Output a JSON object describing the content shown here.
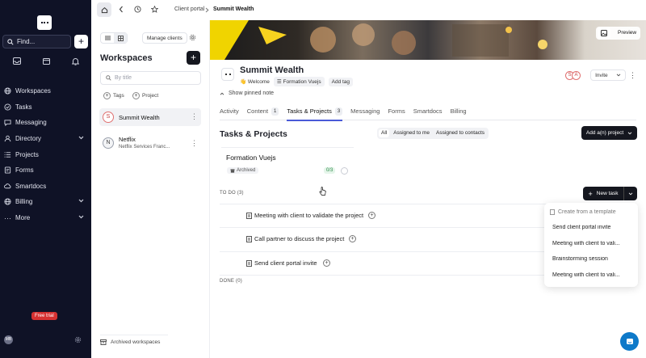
{
  "sidebar": {
    "find_placeholder": "Find...",
    "nav": [
      {
        "label": "Workspaces",
        "icon": "globe-icon"
      },
      {
        "label": "Tasks",
        "icon": "check-circle-icon"
      },
      {
        "label": "Messaging",
        "icon": "chat-icon"
      },
      {
        "label": "Directory",
        "icon": "user-icon",
        "expandable": true
      },
      {
        "label": "Projects",
        "icon": "list-icon"
      },
      {
        "label": "Forms",
        "icon": "form-icon"
      },
      {
        "label": "Smartdocs",
        "icon": "cloud-icon"
      },
      {
        "label": "Billing",
        "icon": "globe-icon",
        "expandable": true
      },
      {
        "label": "More",
        "icon": "dots-icon",
        "expandable": true
      }
    ],
    "free_trial": "Free trial",
    "user_initials": "MB"
  },
  "topbar": {
    "breadcrumb_root": "Client portal",
    "breadcrumb_current": "Summit Wealth"
  },
  "workspaces": {
    "manage_label": "Manage clients",
    "title": "Workspaces",
    "search_placeholder": "By title",
    "filter_tags": "Tags",
    "filter_project": "Project",
    "items": [
      {
        "initial": "S",
        "name": "Summit Wealth",
        "subtitle": ""
      },
      {
        "initial": "N",
        "name": "Netflix",
        "subtitle": "Netflix Services Franc..."
      }
    ],
    "archived_label": "Archived workspaces"
  },
  "main": {
    "preview_label": "Preview",
    "client_name": "Summit Wealth",
    "welcome_label": "Welcome",
    "welcome_emoji": "👋",
    "tag_formation": "Formation Vuejs",
    "add_tag_label": "Add tag",
    "avatars": [
      "S",
      "A"
    ],
    "invite_label": "Invite",
    "pinned_label": "Show pinned note",
    "tabs": [
      {
        "label": "Activity",
        "count": ""
      },
      {
        "label": "Content",
        "count": "1"
      },
      {
        "label": "Tasks & Projects",
        "count": "3"
      },
      {
        "label": "Messaging",
        "count": ""
      },
      {
        "label": "Forms",
        "count": ""
      },
      {
        "label": "Smartdocs",
        "count": ""
      },
      {
        "label": "Billing",
        "count": ""
      }
    ],
    "section_title": "Tasks & Projects",
    "filters": [
      "All",
      "Assigned to me",
      "Assigned to contacts"
    ],
    "add_project_label": "Add a(n) project",
    "project": {
      "title": "Formation Vuejs",
      "status": "Archived",
      "progress": "0/3"
    },
    "todo_label": "TO DO (3)",
    "new_task_label": "New task",
    "tasks": [
      "Meeting with client to validate the project",
      "Call partner to discuss the project",
      "Send client portal invite"
    ],
    "done_label": "DONE (0)",
    "menu": {
      "header": "Create from a template",
      "items": [
        "Send client portal invite",
        "Meeting with client to vali...",
        "Brainstorming session",
        "Meeting with client to vali..."
      ]
    }
  },
  "colors": {
    "sidebar_bg": "#0f1226",
    "accent_tab": "#4a5ad8",
    "primary_button": "#15171f",
    "trial_badge": "#d63131",
    "chat_bubble": "#0e79c9"
  }
}
